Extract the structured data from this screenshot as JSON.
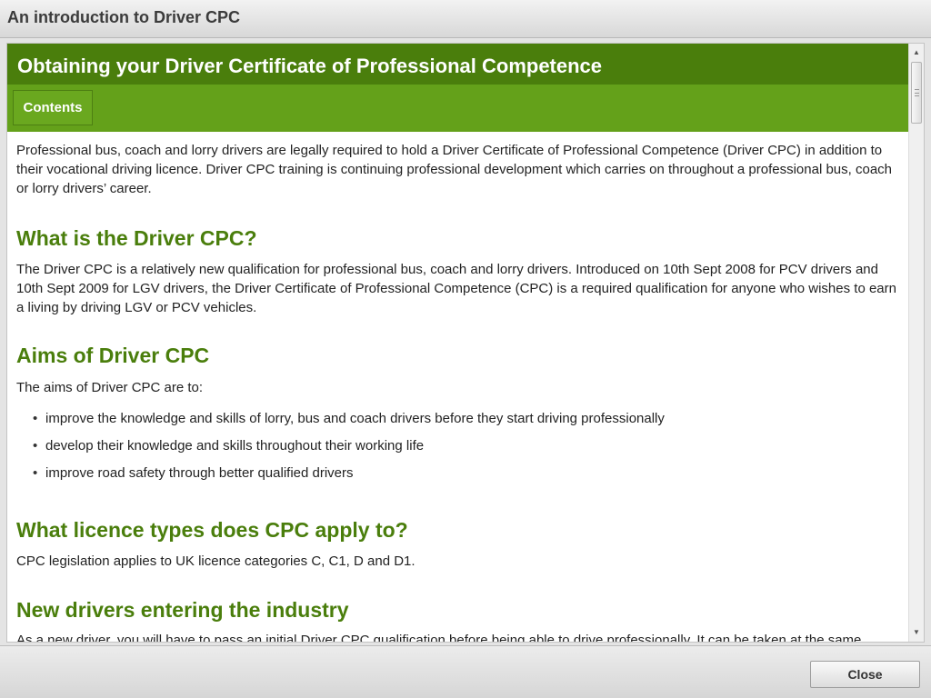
{
  "window": {
    "title": "An introduction to Driver CPC"
  },
  "header": {
    "title": "Obtaining your Driver Certificate of Professional Competence",
    "contents_label": "Contents"
  },
  "content": {
    "intro": "Professional bus, coach and lorry drivers are legally required to hold a Driver Certificate of Professional Competence (Driver CPC) in addition to their vocational driving licence. Driver CPC training is continuing professional development which carries on throughout a professional bus, coach or lorry drivers’ career.",
    "sections": [
      {
        "heading": "What is the Driver CPC?",
        "text": "The Driver CPC is a relatively new qualification for professional bus, coach and lorry drivers. Introduced on 10th Sept 2008 for PCV drivers and 10th Sept 2009 for LGV drivers, the Driver Certificate of Professional Competence (CPC) is a required qualification for anyone who wishes to earn a living by driving LGV or PCV vehicles."
      },
      {
        "heading": "Aims of Driver CPC",
        "text": "The aims of Driver CPC are to:",
        "bullets": [
          "improve the knowledge and skills of lorry, bus and coach drivers before they start driving professionally",
          "develop their knowledge and skills throughout their working life",
          "improve road safety through better qualified drivers"
        ]
      },
      {
        "heading": "What licence types does CPC apply to?",
        "text": "CPC legislation applies to UK licence categories C, C1, D and D1."
      },
      {
        "heading": "New drivers entering the industry",
        "text": "As a new driver, you will have to pass an initial Driver CPC qualification before being able to drive professionally. It can be taken at the same"
      }
    ]
  },
  "scrollbar": {
    "up_icon": "triangle-up-icon",
    "down_icon": "triangle-down-icon"
  },
  "footer": {
    "close_label": "Close"
  },
  "colors": {
    "header_dark": "#4a7e0c",
    "header_light": "#64a11a",
    "heading_text": "#4a7e0c"
  }
}
